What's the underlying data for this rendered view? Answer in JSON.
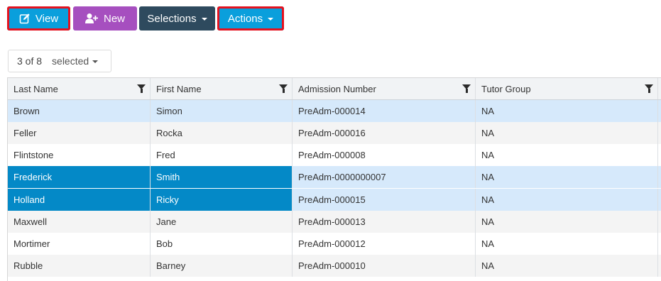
{
  "toolbar": {
    "view_label": "View",
    "new_label": "New",
    "selections_label": "Selections",
    "actions_label": "Actions"
  },
  "selection": {
    "count_text": "3 of 8",
    "selected_label": "selected"
  },
  "grid": {
    "columns": [
      "Last Name",
      "First Name",
      "Admission Number",
      "Tutor Group"
    ],
    "rows": [
      {
        "last": "Brown",
        "first": "Simon",
        "adm": "PreAdm-000014",
        "tutor": "NA",
        "state": "selected"
      },
      {
        "last": "Feller",
        "first": "Rocka",
        "adm": "PreAdm-000016",
        "tutor": "NA",
        "state": "none"
      },
      {
        "last": "Flintstone",
        "first": "Fred",
        "adm": "PreAdm-000008",
        "tutor": "NA",
        "state": "none"
      },
      {
        "last": "Frederick",
        "first": "Smith",
        "adm": "PreAdm-0000000007",
        "tutor": "NA",
        "state": "selected-active"
      },
      {
        "last": "Holland",
        "first": "Ricky",
        "adm": "PreAdm-000015",
        "tutor": "NA",
        "state": "selected-active"
      },
      {
        "last": "Maxwell",
        "first": "Jane",
        "adm": "PreAdm-000013",
        "tutor": "NA",
        "state": "none"
      },
      {
        "last": "Mortimer",
        "first": "Bob",
        "adm": "PreAdm-000012",
        "tutor": "NA",
        "state": "none"
      },
      {
        "last": "Rubble",
        "first": "Barney",
        "adm": "PreAdm-000010",
        "tutor": "NA",
        "state": "none"
      }
    ]
  },
  "colors": {
    "view_button": "#0a9fdc",
    "new_button": "#a64fbf",
    "selections_button": "#2e4a5e",
    "actions_button": "#0a9fdc",
    "highlight_outline": "#e4121f",
    "selected_row": "#d6e9fb",
    "active_cell": "#0489c7"
  },
  "icons": {
    "view": "edit-icon",
    "new": "add-user-icon",
    "filter": "filter-icon"
  }
}
